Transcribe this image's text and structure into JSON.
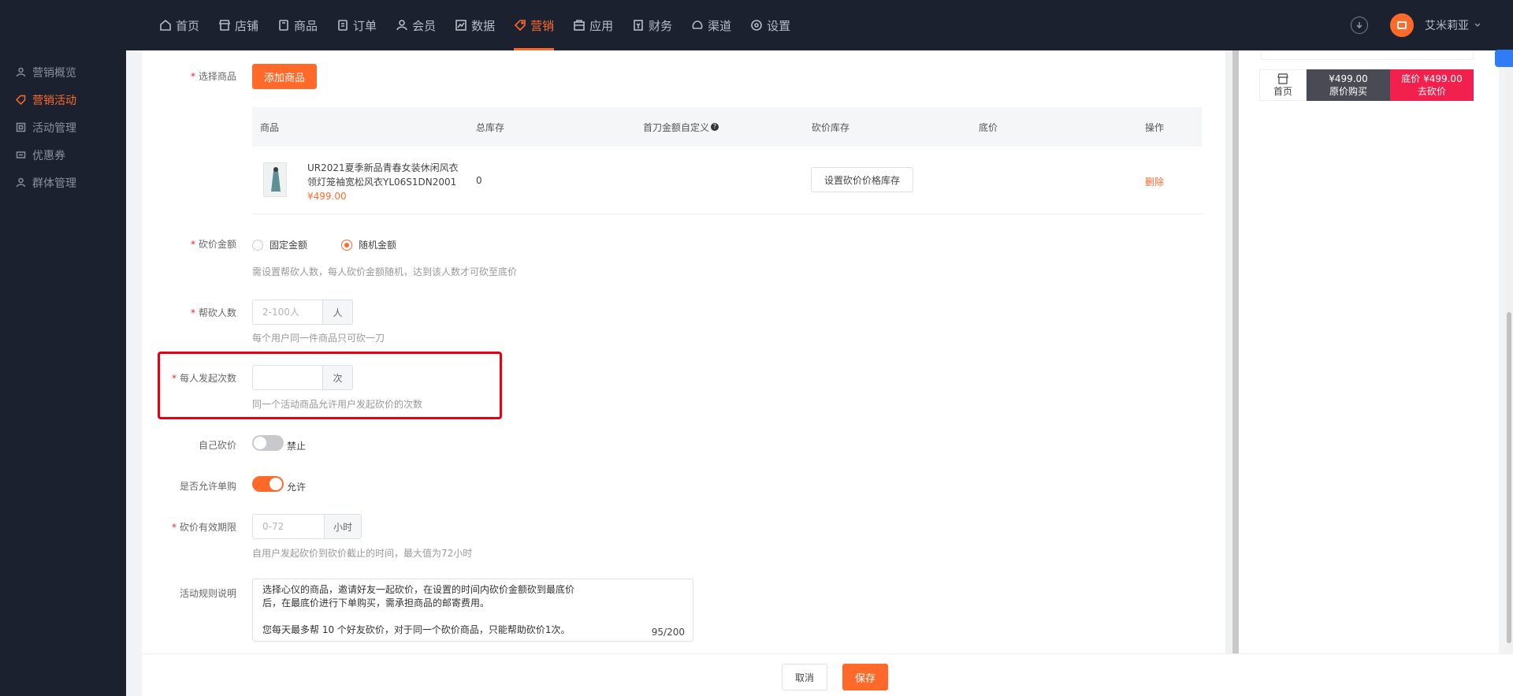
{
  "nav": {
    "items": [
      {
        "label": "首页",
        "icon": "home-icon"
      },
      {
        "label": "店铺",
        "icon": "shop-icon"
      },
      {
        "label": "商品",
        "icon": "goods-icon"
      },
      {
        "label": "订单",
        "icon": "order-icon"
      },
      {
        "label": "会员",
        "icon": "member-icon"
      },
      {
        "label": "数据",
        "icon": "chart-icon"
      },
      {
        "label": "营销",
        "icon": "tag-icon",
        "active": true
      },
      {
        "label": "应用",
        "icon": "app-icon"
      },
      {
        "label": "财务",
        "icon": "finance-icon"
      },
      {
        "label": "渠道",
        "icon": "channel-icon"
      },
      {
        "label": "设置",
        "icon": "gear-icon"
      }
    ],
    "user_name": "艾米莉亚"
  },
  "sidebar": {
    "items": [
      {
        "label": "营销概览"
      },
      {
        "label": "营销活动",
        "active": true
      },
      {
        "label": "活动管理"
      },
      {
        "label": "优惠券"
      },
      {
        "label": "群体管理"
      }
    ]
  },
  "form": {
    "select_goods": {
      "label": "选择商品",
      "button": "添加商品"
    },
    "table": {
      "headers": [
        "商品",
        "总库存",
        "首刀金额自定义",
        "砍价库存",
        "底价",
        "操作"
      ],
      "row": {
        "name_line1": "UR2021夏季新品青春女装休闲风衣",
        "name_line2": "领灯笼袖宽松风衣YL06S1DN2001",
        "price": "¥499.00",
        "stock": "0",
        "set_stock_button": "设置砍价价格库存",
        "delete": "删除"
      }
    },
    "bargain_amount": {
      "label": "砍价金额",
      "option_fixed": "固定金额",
      "option_random": "随机金额",
      "selected": "随机金额",
      "hint": "需设置帮砍人数，每人砍价金额随机，达到该人数才可砍至底价"
    },
    "helpers": {
      "label": "帮砍人数",
      "placeholder": "2-100人",
      "suffix": "人",
      "hint": "每个用户同一件商品只可砍一刀"
    },
    "per_person": {
      "label": "每人发起次数",
      "value": "",
      "suffix": "次",
      "hint": "同一个活动商品允许用户发起砍价的次数"
    },
    "self_bargain": {
      "label": "自己砍价",
      "state": "禁止"
    },
    "single_buy": {
      "label": "是否允许单购",
      "state": "允许"
    },
    "validity": {
      "label": "砍价有效期限",
      "placeholder": "0-72",
      "suffix": "小时",
      "hint": "自用户发起砍价到砍价截止的时间，最大值为72小时"
    },
    "rules": {
      "label": "活动规则说明",
      "line1": "选择心仪的商品，邀请好友一起砍价，在设置的时间内砍价金额砍到最底价",
      "line2": "后，在最底价进行下单购买，需承担商品的邮寄费用。",
      "line3": "您每天最多帮  10 个好友砍价，对于同一个砍价商品，只能帮助砍价1次。",
      "count": "95/200"
    }
  },
  "footer": {
    "cancel": "取消",
    "save": "保存"
  },
  "preview": {
    "home": "首页",
    "orig_price": "¥499.00",
    "orig_label": "原价购买",
    "cut_price": "底价 ¥499.00",
    "cut_label": "去砍价"
  },
  "colors": {
    "accent": "#ff6a2b",
    "highlight": "#e60012",
    "nav_bg": "#1c2130"
  }
}
